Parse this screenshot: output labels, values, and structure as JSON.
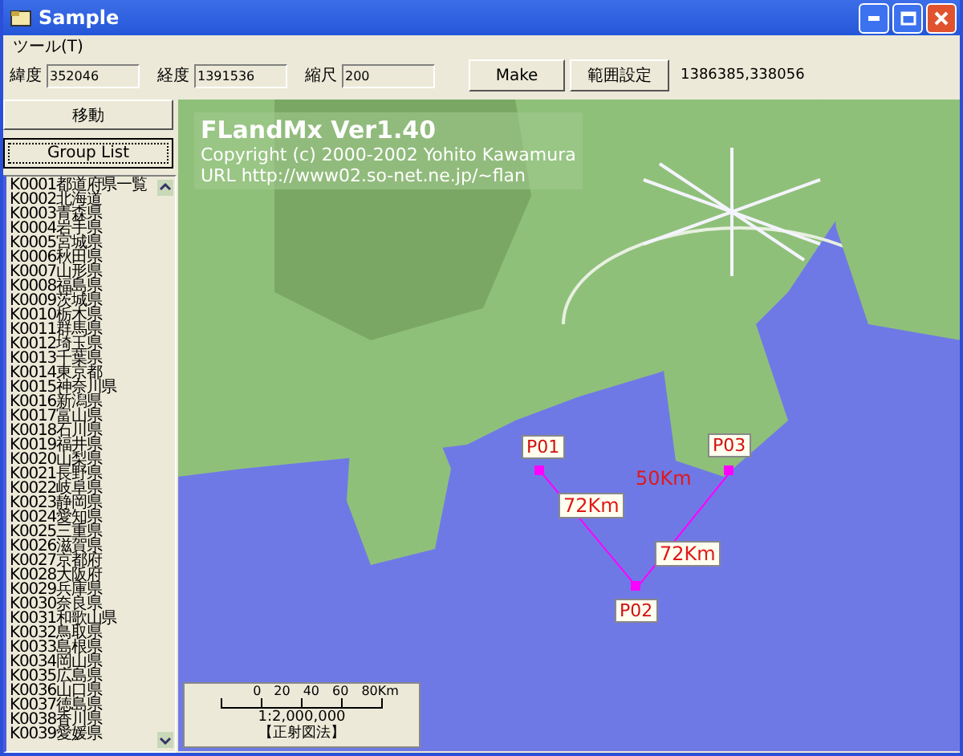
{
  "window": {
    "title": "Sample"
  },
  "menu": [
    {
      "label": "ツール(T)"
    }
  ],
  "toolbar": {
    "fields": [
      {
        "label": "緯度",
        "value": "352046"
      },
      {
        "label": "経度",
        "value": "1391536"
      },
      {
        "label": "縮尺",
        "value": "200"
      }
    ],
    "buttons": [
      {
        "label": "Make"
      },
      {
        "label": "範囲設定"
      }
    ],
    "readout": "1386385,338056"
  },
  "sidebar": {
    "buttons": [
      {
        "label": "移動",
        "focused": false
      },
      {
        "label": "Group List",
        "focused": true
      }
    ],
    "items": [
      {
        "label": "K0001都道府県一覧",
        "selected": false
      },
      {
        "label": "K0002北海道",
        "selected": false
      },
      {
        "label": "K0003青森県",
        "selected": false
      },
      {
        "label": "K0004岩手県",
        "selected": false
      },
      {
        "label": "K0005宮城県",
        "selected": false
      },
      {
        "label": "K0006秋田県",
        "selected": false
      },
      {
        "label": "K0007山形県",
        "selected": false
      },
      {
        "label": "K0008福島県",
        "selected": false
      },
      {
        "label": "K0009茨城県",
        "selected": false
      },
      {
        "label": "K0010栃木県",
        "selected": false
      },
      {
        "label": "K0011群馬県",
        "selected": false
      },
      {
        "label": "K0012埼玉県",
        "selected": false
      },
      {
        "label": "K0013千葉県",
        "selected": false
      },
      {
        "label": "K0014東京都",
        "selected": false
      },
      {
        "label": "K0015神奈川県",
        "selected": false
      },
      {
        "label": "K0016新潟県",
        "selected": false
      },
      {
        "label": "K0017富山県",
        "selected": false
      },
      {
        "label": "K0018石川県",
        "selected": false
      },
      {
        "label": "K0019福井県",
        "selected": false
      },
      {
        "label": "K0020山梨県",
        "selected": false
      },
      {
        "label": "K0021長野県",
        "selected": false
      },
      {
        "label": "K0022岐阜県",
        "selected": false
      },
      {
        "label": "K0023静岡県",
        "selected": false
      },
      {
        "label": "K0024愛知県",
        "selected": false
      },
      {
        "label": "K0025三重県",
        "selected": false
      },
      {
        "label": "K0026滋賀県",
        "selected": false
      },
      {
        "label": "K0027京都府",
        "selected": false
      },
      {
        "label": "K0028大阪府",
        "selected": false
      },
      {
        "label": "K0029兵庫県",
        "selected": false
      },
      {
        "label": "K0030奈良県",
        "selected": false
      },
      {
        "label": "K0031和歌山県",
        "selected": false
      },
      {
        "label": "K0032鳥取県",
        "selected": false
      },
      {
        "label": "K0033島根県",
        "selected": false
      },
      {
        "label": "K0034岡山県",
        "selected": false
      },
      {
        "label": "K0035広島県",
        "selected": false
      },
      {
        "label": "K0036山口県",
        "selected": false
      },
      {
        "label": "K0037徳島県",
        "selected": false
      },
      {
        "label": "K0038香川県",
        "selected": false
      },
      {
        "label": "K0039愛媛県",
        "selected": false
      }
    ]
  },
  "map": {
    "title": "FLandMx Ver1.40",
    "copyright": "Copyright (c) 2000-2002 Yohito Kawamura",
    "url": "URL http://www02.so-net.ne.jp/~flan",
    "points": [
      {
        "label": "P01"
      },
      {
        "label": "P02"
      },
      {
        "label": "P03"
      }
    ],
    "distances": [
      {
        "label": "72Km",
        "kind": "boxed"
      },
      {
        "label": "72Km",
        "kind": "boxed"
      },
      {
        "label": "50Km",
        "kind": "plain"
      }
    ],
    "scale": {
      "ticks": [
        "0",
        "20",
        "40",
        "60",
        "80Km"
      ],
      "ratio": "1:2,000,000",
      "projection": "【正射図法】"
    }
  }
}
